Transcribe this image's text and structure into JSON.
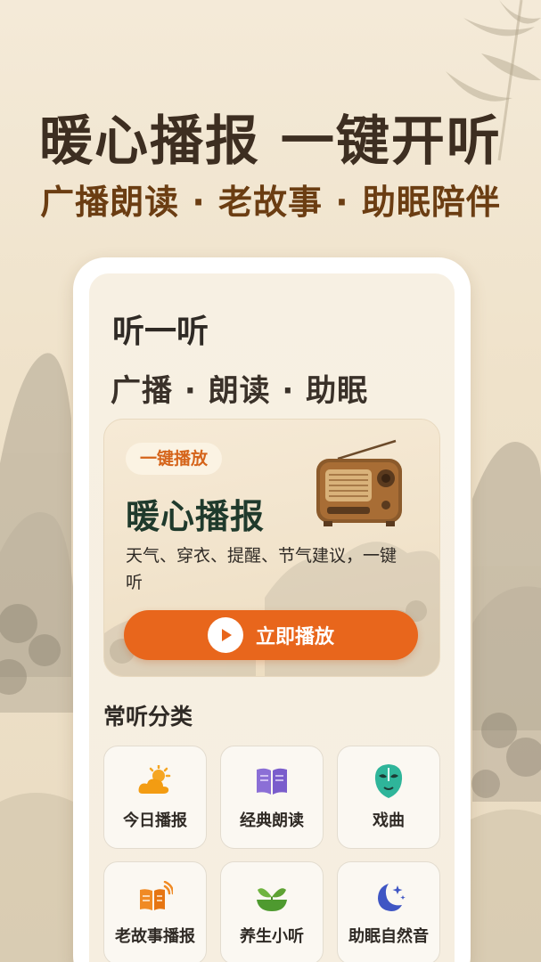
{
  "promo": {
    "title": "暖心播报 一键开听",
    "subtitle": "广播朗读 · 老故事 · 助眠陪伴"
  },
  "app": {
    "title": "听一听",
    "tagline": "广播 · 朗读 · 助眠"
  },
  "hero": {
    "badge": "一键播放",
    "title": "暖心播报",
    "description": "天气、穿衣、提醒、节气建议，一键听",
    "play_label": "立即播放",
    "image_icon": "vintage-radio-icon"
  },
  "categories_section": {
    "title": "常听分类",
    "items": [
      {
        "label": "今日播报",
        "icon": "weather-icon"
      },
      {
        "label": "经典朗读",
        "icon": "book-icon"
      },
      {
        "label": "戏曲",
        "icon": "opera-mask-icon"
      },
      {
        "label": "老故事播报",
        "icon": "story-broadcast-icon"
      },
      {
        "label": "养生小听",
        "icon": "herb-bowl-icon"
      },
      {
        "label": "助眠自然音",
        "icon": "moon-stars-icon"
      }
    ]
  },
  "colors": {
    "accent": "#e8661c",
    "hero_title": "#1f3a2c",
    "subtitle": "#6b3d12",
    "background": "#f4ead8"
  }
}
